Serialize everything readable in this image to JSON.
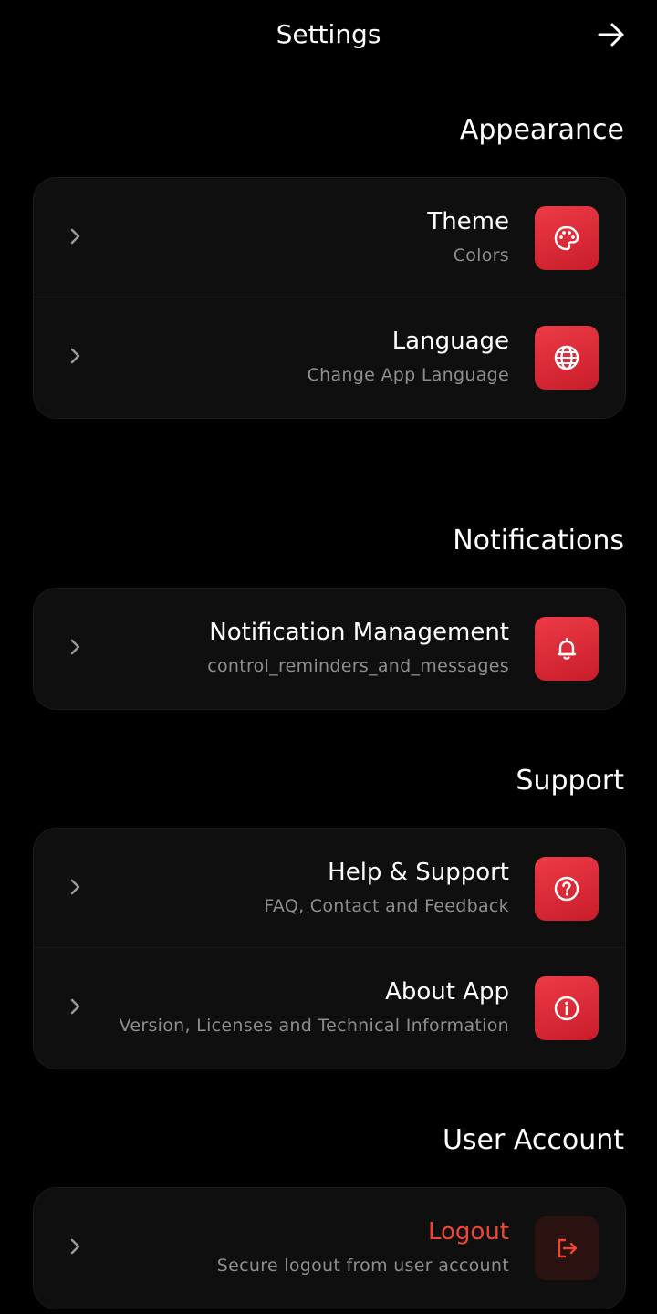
{
  "header": {
    "title": "Settings",
    "forward_icon": "arrow-right-icon"
  },
  "colors": {
    "background": "#000000",
    "card": "#0f0f0f",
    "accent": "#e0303c",
    "logout_text": "#ef4533",
    "subtitle": "#8e8e8e"
  },
  "sections": {
    "appearance": {
      "title": "Appearance",
      "items": [
        {
          "title": "Theme",
          "subtitle": "Colors",
          "icon": "palette-icon"
        },
        {
          "title": "Language",
          "subtitle": "Change App Language",
          "icon": "globe-icon"
        }
      ]
    },
    "notifications": {
      "title": "Notifications",
      "items": [
        {
          "title": "Notification Management",
          "subtitle": "control_reminders_and_messages",
          "icon": "bell-icon"
        }
      ]
    },
    "support": {
      "title": "Support",
      "items": [
        {
          "title": "Help & Support",
          "subtitle": "FAQ, Contact and Feedback",
          "icon": "help-icon"
        },
        {
          "title": "About App",
          "subtitle": "Version, Licenses and Technical Information",
          "icon": "info-icon"
        }
      ]
    },
    "account": {
      "title": "User Account",
      "items": [
        {
          "title": "Logout",
          "subtitle": "Secure logout from user account",
          "icon": "logout-icon"
        }
      ]
    }
  }
}
